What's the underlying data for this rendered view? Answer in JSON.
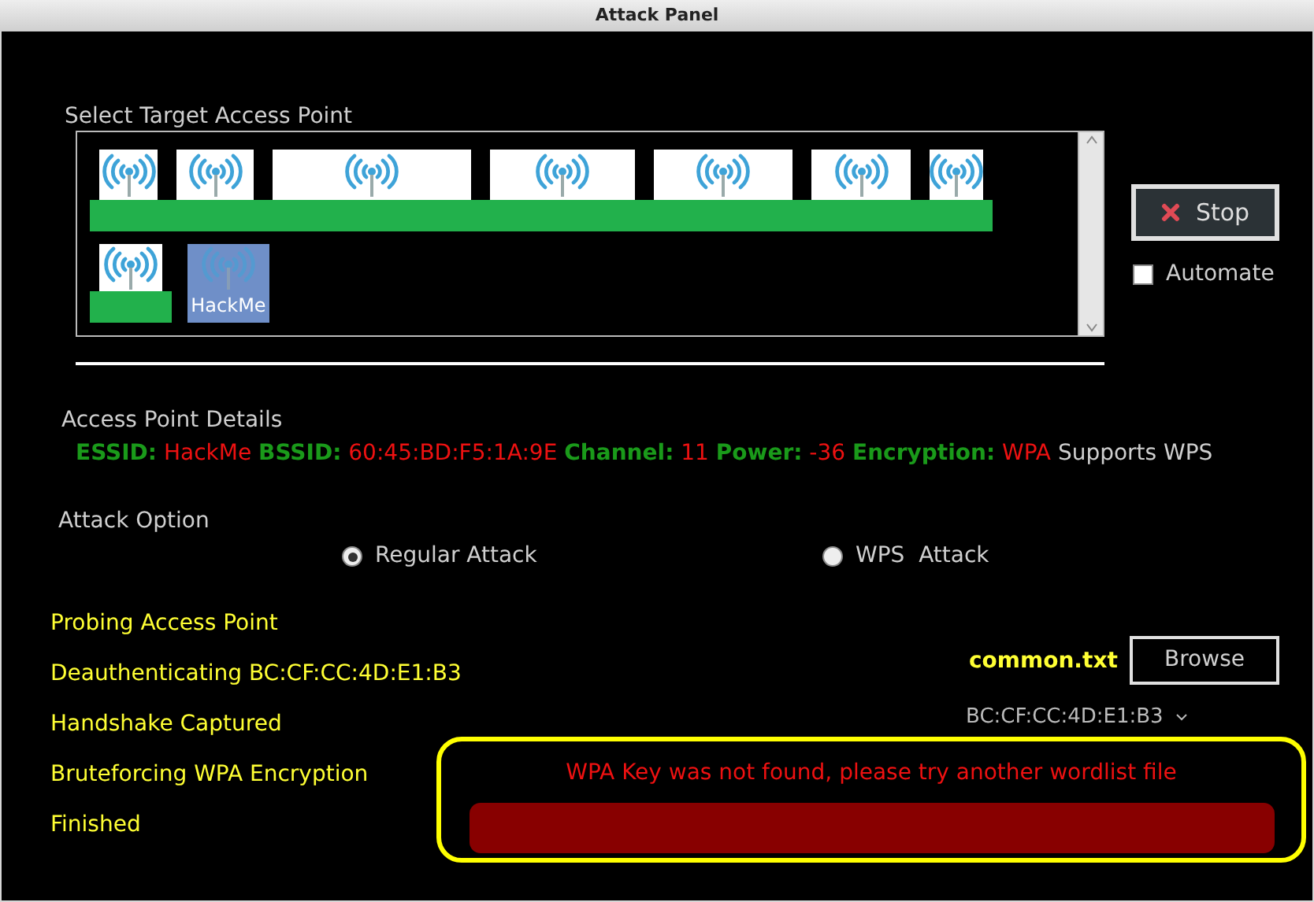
{
  "window": {
    "title": "Attack Panel"
  },
  "target_list": {
    "label": "Select Target Access Point",
    "access_points": [
      {
        "selected": false
      },
      {
        "selected": false
      },
      {
        "selected": false
      },
      {
        "selected": false
      },
      {
        "selected": false
      },
      {
        "selected": false
      },
      {
        "selected": false
      },
      {
        "selected": false
      },
      {
        "label": "HackMe",
        "selected": true
      }
    ]
  },
  "stop_button": {
    "label": "Stop"
  },
  "automate": {
    "label": "Automate",
    "checked": false
  },
  "details": {
    "label": "Access Point Details",
    "fields": [
      {
        "kind": "pair",
        "label": "ESSID:",
        "value": "HackMe"
      },
      {
        "kind": "pair",
        "label": "BSSID:",
        "value": "60:45:BD:F5:1A:9E"
      },
      {
        "kind": "pair",
        "label": "Channel:",
        "value": "11"
      },
      {
        "kind": "pair",
        "label": "Power:",
        "value": "-36"
      },
      {
        "kind": "pair",
        "label": "Encryption:",
        "value": "WPA"
      },
      {
        "kind": "note",
        "label": "Supports WPS"
      }
    ]
  },
  "attack_option": {
    "label": "Attack Option",
    "options": [
      {
        "label": "Regular Attack",
        "selected": true
      },
      {
        "label": "WPS  Attack",
        "selected": false
      }
    ]
  },
  "progress": [
    "Probing Access Point",
    "Deauthenticating BC:CF:CC:4D:E1:B3",
    "Handshake Captured",
    "Bruteforcing WPA Encryption",
    "Finished"
  ],
  "wordlist": {
    "file": "common.txt",
    "button": "Browse",
    "client": "BC:CF:CC:4D:E1:B3"
  },
  "result": {
    "message": "WPA Key was not found, please try another wordlist file"
  }
}
